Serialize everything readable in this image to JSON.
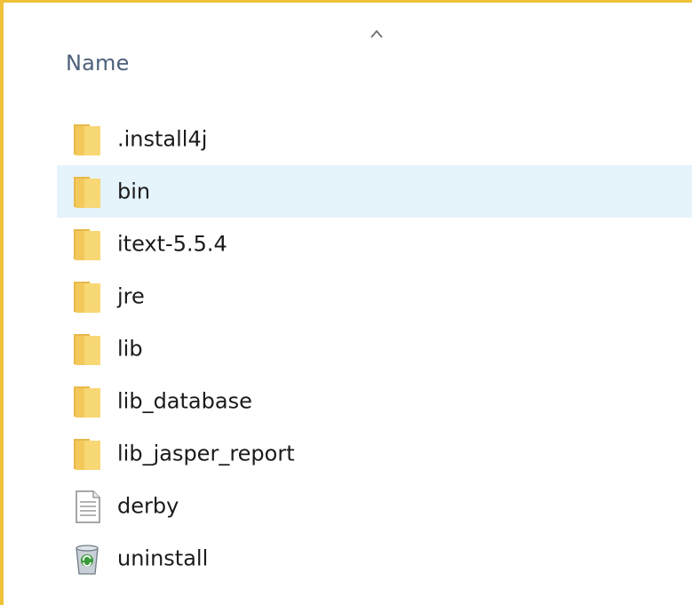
{
  "explorer": {
    "column_header": "Name",
    "sort_indicator": "ascending",
    "hovered_item": "bin",
    "items": [
      {
        "name": ".install4j",
        "type": "folder",
        "icon": "folder-icon"
      },
      {
        "name": "bin",
        "type": "folder",
        "icon": "folder-icon"
      },
      {
        "name": "itext-5.5.4",
        "type": "folder",
        "icon": "folder-icon"
      },
      {
        "name": "jre",
        "type": "folder",
        "icon": "folder-icon"
      },
      {
        "name": "lib",
        "type": "folder",
        "icon": "folder-icon"
      },
      {
        "name": "lib_database",
        "type": "folder",
        "icon": "folder-icon"
      },
      {
        "name": "lib_jasper_report",
        "type": "folder",
        "icon": "folder-icon"
      },
      {
        "name": "derby",
        "type": "file",
        "icon": "document-icon"
      },
      {
        "name": "uninstall",
        "type": "application",
        "icon": "recycle-bin-icon"
      }
    ]
  },
  "colors": {
    "frame_border": "#f0c23a",
    "hover_background": "#e5f3fb",
    "header_text": "#4c607a",
    "folder": "#f8d775"
  }
}
